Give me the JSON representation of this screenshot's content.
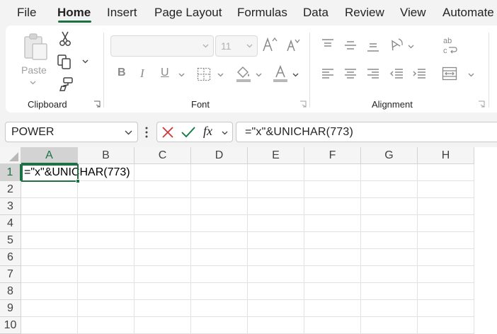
{
  "menu": {
    "tabs": [
      {
        "label": "File"
      },
      {
        "label": "Home"
      },
      {
        "label": "Insert"
      },
      {
        "label": "Page Layout"
      },
      {
        "label": "Formulas"
      },
      {
        "label": "Data"
      },
      {
        "label": "Review"
      },
      {
        "label": "View"
      },
      {
        "label": "Automate"
      }
    ],
    "active": "Home"
  },
  "ribbon": {
    "clipboard": {
      "label": "Clipboard",
      "paste_label": "Paste"
    },
    "font": {
      "label": "Font",
      "font_name": "",
      "font_size": "11"
    },
    "alignment": {
      "label": "Alignment"
    }
  },
  "formula_bar": {
    "name_box": "POWER",
    "formula": "=\"x\"&UNICHAR(773)"
  },
  "sheet": {
    "columns": [
      "A",
      "B",
      "C",
      "D",
      "E",
      "F",
      "G",
      "H"
    ],
    "rows": [
      "1",
      "2",
      "3",
      "4",
      "5",
      "6",
      "7",
      "8",
      "9",
      "10"
    ],
    "active_cell": "A1",
    "cells": {
      "A1": "=\"x\"&UNICHAR(773)"
    }
  },
  "colors": {
    "accent": "#1e7145",
    "ribbon_bg": "#ffffff",
    "window_bg": "#f3f3f3"
  },
  "icons": [
    "paste-icon",
    "cut-icon",
    "copy-icon",
    "format-painter-icon",
    "bold-icon",
    "italic-icon",
    "underline-icon",
    "borders-icon",
    "fill-color-icon",
    "font-color-icon",
    "increase-font-icon",
    "decrease-font-icon",
    "align-top-icon",
    "align-middle-icon",
    "align-bottom-icon",
    "orientation-icon",
    "wrap-text-icon",
    "align-left-icon",
    "align-center-icon",
    "align-right-icon",
    "decrease-indent-icon",
    "increase-indent-icon",
    "merge-icon",
    "cancel-icon",
    "enter-icon",
    "fx-icon"
  ]
}
